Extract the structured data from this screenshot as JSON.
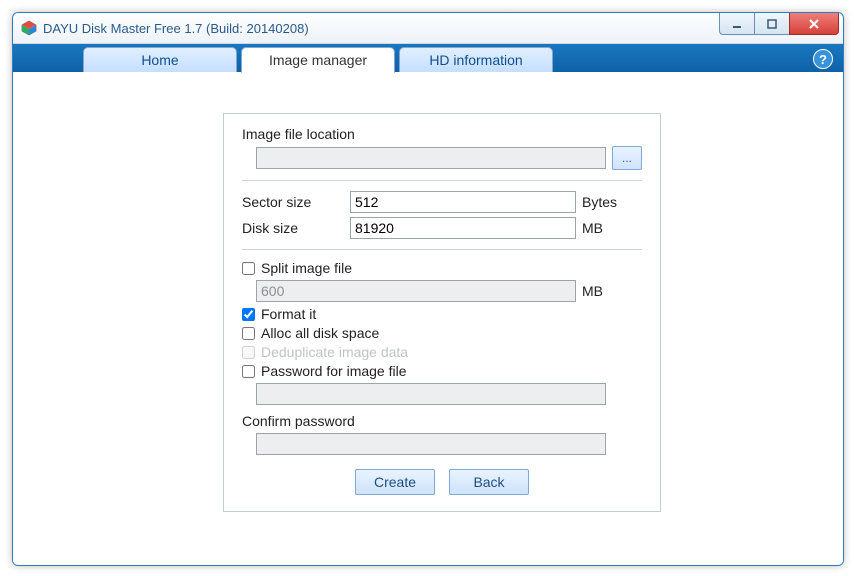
{
  "window": {
    "title": "DAYU Disk Master Free 1.7  (Build: 20140208)"
  },
  "tabs": {
    "home": "Home",
    "image_manager": "Image manager",
    "hd_info": "HD information"
  },
  "help_glyph": "?",
  "form": {
    "image_location_label": "Image file location",
    "image_location_value": "",
    "browse_label": "...",
    "sector_size_label": "Sector size",
    "sector_size_value": "512",
    "sector_size_unit": "Bytes",
    "disk_size_label": "Disk size",
    "disk_size_value": "81920",
    "disk_size_unit": "MB",
    "split_label": "Split image file",
    "split_checked": false,
    "split_value": "600",
    "split_unit": "MB",
    "format_label": "Format it",
    "format_checked": true,
    "alloc_label": "Alloc all disk space",
    "alloc_checked": false,
    "dedup_label": "Deduplicate image data",
    "dedup_checked": false,
    "password_label": "Password for image file",
    "password_checked": false,
    "password_value": "",
    "confirm_label": "Confirm password",
    "confirm_value": ""
  },
  "buttons": {
    "create": "Create",
    "back": "Back"
  }
}
